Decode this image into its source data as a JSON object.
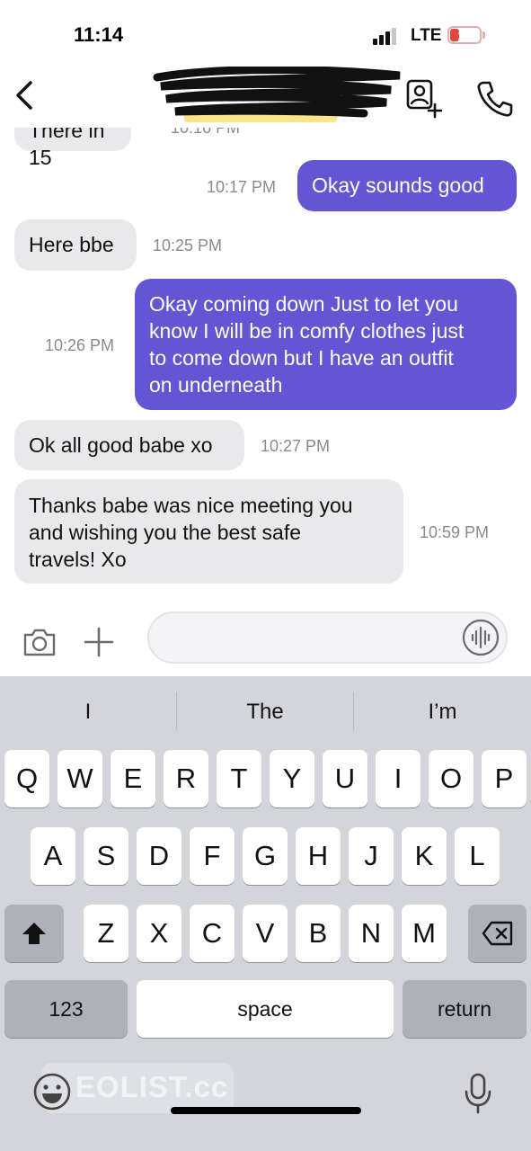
{
  "status_bar": {
    "time": "11:14",
    "network": "LTE",
    "battery_level": "16"
  },
  "nav": {
    "contact_name_redacted": true,
    "icons": [
      "back-chevron-icon",
      "add-contact-icon",
      "phone-icon"
    ]
  },
  "messages": [
    {
      "direction": "incoming",
      "text": "There in 15",
      "time": "10:16 PM",
      "partially_hidden": true
    },
    {
      "direction": "outgoing",
      "text": "Okay sounds good",
      "time": "10:17 PM"
    },
    {
      "direction": "incoming",
      "text": "Here bbe",
      "time": "10:25 PM"
    },
    {
      "direction": "outgoing",
      "lines": [
        "Okay coming down Just to let you",
        "know I will be in comfy clothes just",
        "to come down but I have an outfit",
        "on underneath"
      ],
      "time": "10:26 PM"
    },
    {
      "direction": "incoming",
      "text": "Ok all good babe xo",
      "time": "10:27 PM"
    },
    {
      "direction": "incoming",
      "lines": [
        "Thanks babe was nice meeting you",
        "and wishing you the best safe",
        "travels! Xo"
      ],
      "time": "10:59 PM"
    }
  ],
  "composer": {
    "placeholder": "",
    "icons": [
      "camera-icon",
      "plus-icon",
      "voice-waveform-icon"
    ]
  },
  "keyboard": {
    "suggestions": [
      "I",
      "The",
      "I’m"
    ],
    "row1": [
      "Q",
      "W",
      "E",
      "R",
      "T",
      "Y",
      "U",
      "I",
      "O",
      "P"
    ],
    "row2": [
      "A",
      "S",
      "D",
      "F",
      "G",
      "H",
      "J",
      "K",
      "L"
    ],
    "row3": [
      "Z",
      "X",
      "C",
      "V",
      "B",
      "N",
      "M"
    ],
    "numbers_label": "123",
    "space_label": "space",
    "return_label": "return",
    "icons": [
      "shift-icon",
      "delete-icon",
      "emoji-icon",
      "microphone-icon"
    ]
  },
  "watermark": "EOLIST.cc",
  "colors": {
    "outgoing_bubble": "#6356d4",
    "incoming_bubble": "#e9e9eb",
    "battery_low": "#e0483f"
  }
}
